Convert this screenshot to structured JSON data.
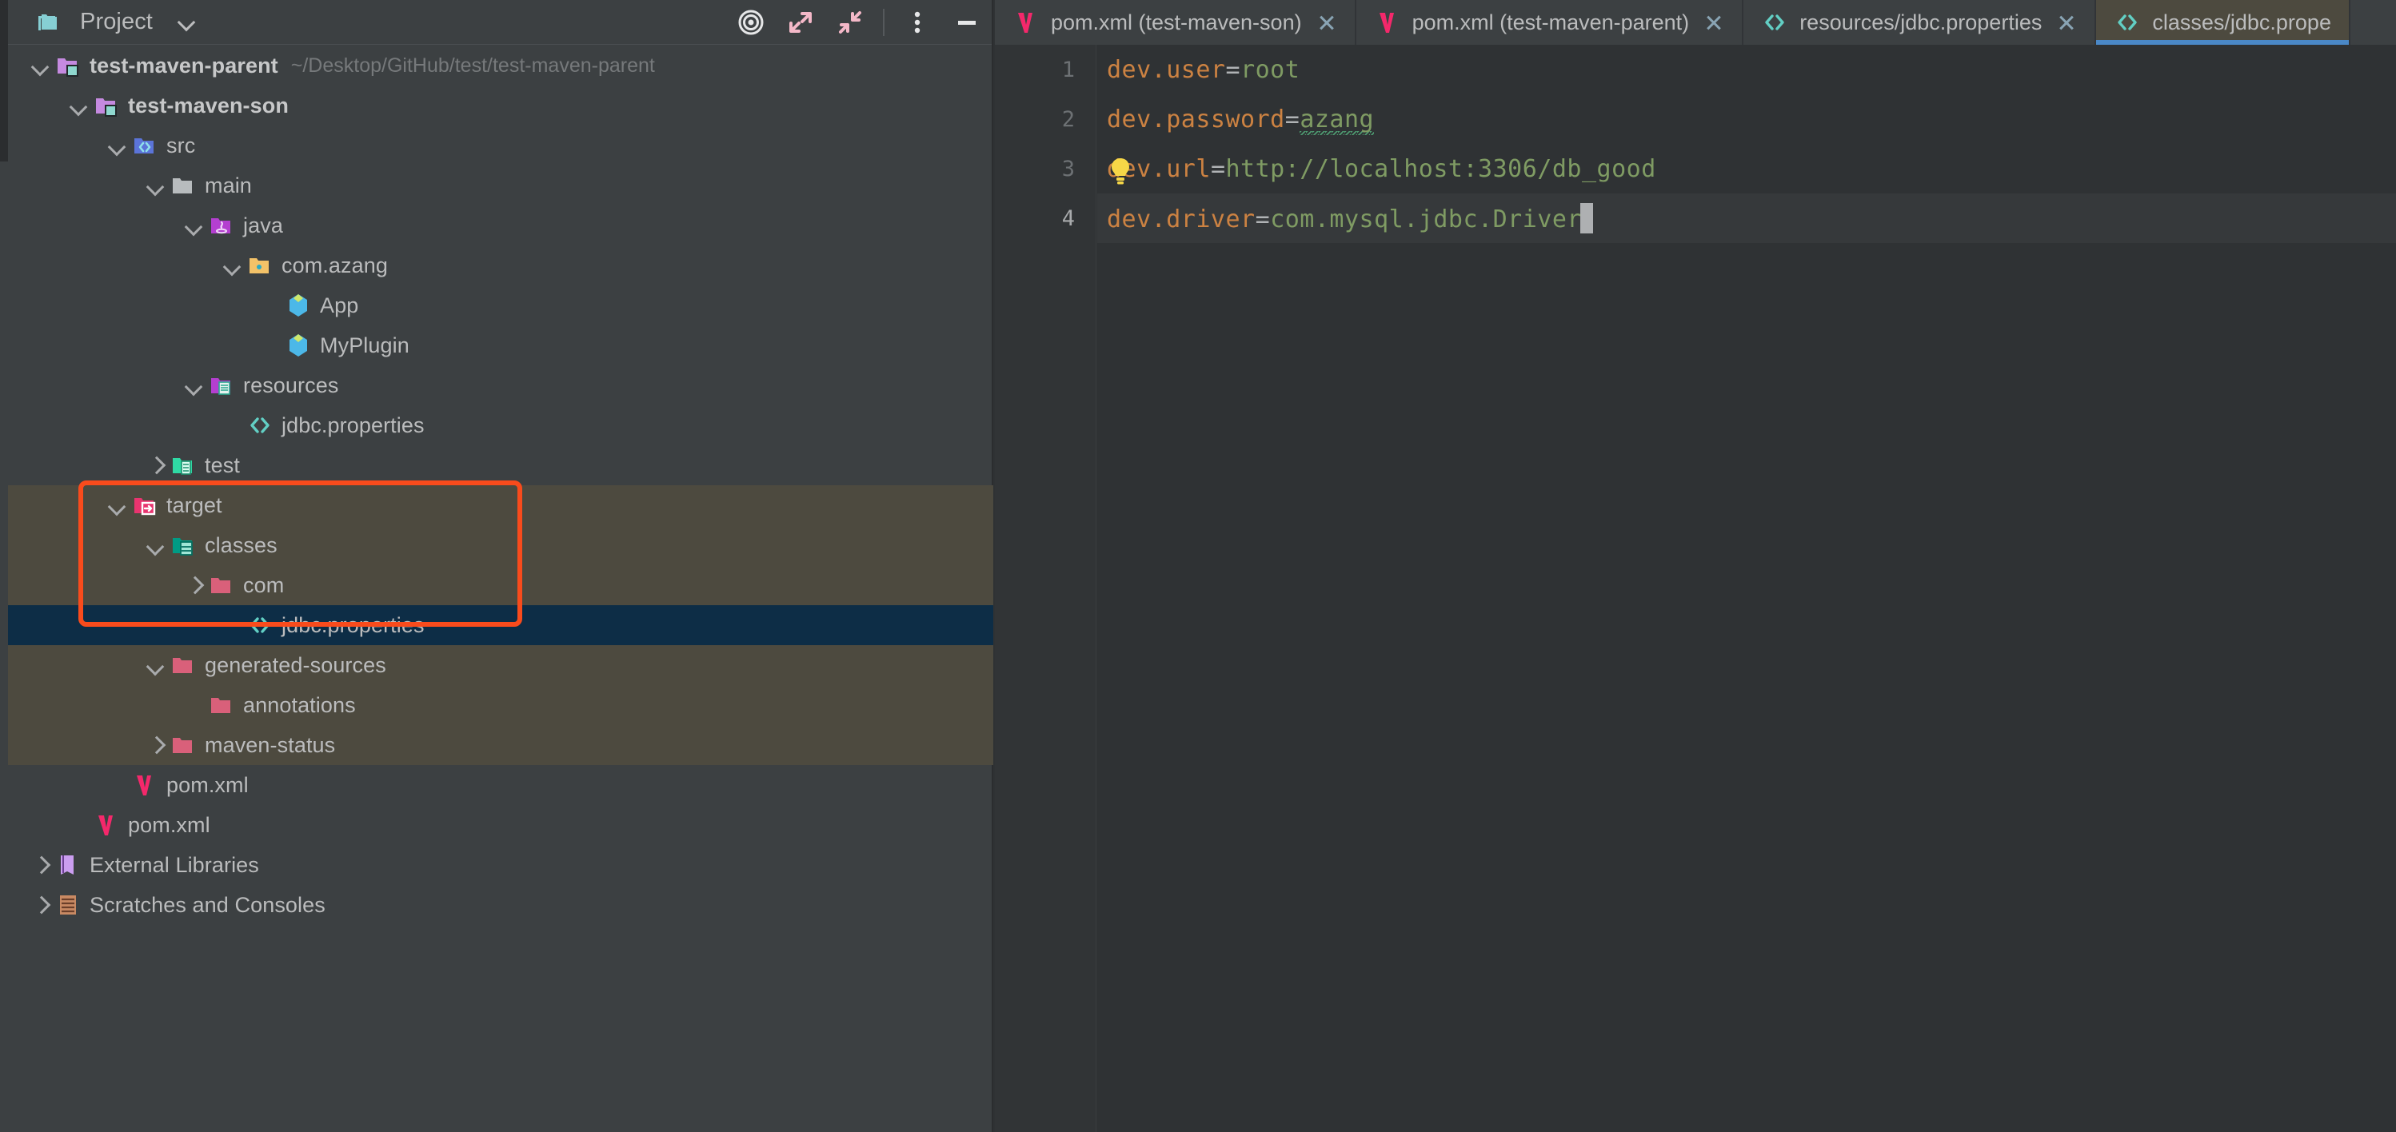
{
  "panel": {
    "title": "Project",
    "title_icon": "project-folder-icon",
    "dropdown_icon": "chevron-down-icon",
    "tools": [
      {
        "name": "locate-target-icon",
        "label": "Select Opened File"
      },
      {
        "name": "expand-all-icon",
        "label": "Expand All"
      },
      {
        "name": "collapse-all-icon",
        "label": "Collapse All"
      },
      {
        "name": "more-options-icon",
        "label": "Options"
      },
      {
        "name": "minimize-icon",
        "label": "Hide"
      }
    ]
  },
  "tree": [
    {
      "label": "test-maven-parent",
      "path_hint": "~/Desktop/GitHub/test/test-maven-parent",
      "depth": 0,
      "arrow": "down",
      "icon": "module-icon",
      "bold": true,
      "excluded": false,
      "selected": false
    },
    {
      "label": "test-maven-son",
      "path_hint": "",
      "depth": 1,
      "arrow": "down",
      "icon": "module-icon",
      "bold": true,
      "excluded": false,
      "selected": false
    },
    {
      "label": "src",
      "path_hint": "",
      "depth": 2,
      "arrow": "down",
      "icon": "source-folder-icon",
      "bold": false,
      "excluded": false,
      "selected": false
    },
    {
      "label": "main",
      "path_hint": "",
      "depth": 3,
      "arrow": "down",
      "icon": "folder-gray-icon",
      "bold": false,
      "excluded": false,
      "selected": false
    },
    {
      "label": "java",
      "path_hint": "",
      "depth": 4,
      "arrow": "down",
      "icon": "java-source-root-icon",
      "bold": false,
      "excluded": false,
      "selected": false
    },
    {
      "label": "com.azang",
      "path_hint": "",
      "depth": 5,
      "arrow": "down",
      "icon": "package-icon",
      "bold": false,
      "excluded": false,
      "selected": false
    },
    {
      "label": "App",
      "path_hint": "",
      "depth": 6,
      "arrow": "none",
      "icon": "java-class-icon",
      "bold": false,
      "excluded": false,
      "selected": false
    },
    {
      "label": "MyPlugin",
      "path_hint": "",
      "depth": 6,
      "arrow": "none",
      "icon": "java-class-icon",
      "bold": false,
      "excluded": false,
      "selected": false
    },
    {
      "label": "resources",
      "path_hint": "",
      "depth": 4,
      "arrow": "down",
      "icon": "resource-root-icon",
      "bold": false,
      "excluded": false,
      "selected": false
    },
    {
      "label": "jdbc.properties",
      "path_hint": "",
      "depth": 5,
      "arrow": "none",
      "icon": "properties-file-icon",
      "bold": false,
      "excluded": false,
      "selected": false
    },
    {
      "label": "test",
      "path_hint": "",
      "depth": 3,
      "arrow": "right",
      "icon": "test-root-icon",
      "bold": false,
      "excluded": false,
      "selected": false
    },
    {
      "label": "target",
      "path_hint": "",
      "depth": 2,
      "arrow": "down",
      "icon": "excluded-output-icon",
      "bold": false,
      "excluded": true,
      "selected": false
    },
    {
      "label": "classes",
      "path_hint": "",
      "depth": 3,
      "arrow": "down",
      "icon": "module-output-icon",
      "bold": false,
      "excluded": true,
      "selected": false
    },
    {
      "label": "com",
      "path_hint": "",
      "depth": 4,
      "arrow": "right",
      "icon": "folder-rose-icon",
      "bold": false,
      "excluded": true,
      "selected": false
    },
    {
      "label": "jdbc.properties",
      "path_hint": "",
      "depth": 5,
      "arrow": "none",
      "icon": "properties-file-icon",
      "bold": false,
      "excluded": false,
      "selected": true
    },
    {
      "label": "generated-sources",
      "path_hint": "",
      "depth": 3,
      "arrow": "down",
      "icon": "folder-rose-icon",
      "bold": false,
      "excluded": true,
      "selected": false
    },
    {
      "label": "annotations",
      "path_hint": "",
      "depth": 4,
      "arrow": "none",
      "icon": "folder-rose-icon",
      "bold": false,
      "excluded": true,
      "selected": false
    },
    {
      "label": "maven-status",
      "path_hint": "",
      "depth": 3,
      "arrow": "right",
      "icon": "folder-rose-icon",
      "bold": false,
      "excluded": true,
      "selected": false
    },
    {
      "label": "pom.xml",
      "path_hint": "",
      "depth": 2,
      "arrow": "none",
      "icon": "maven-icon",
      "bold": false,
      "excluded": false,
      "selected": false
    },
    {
      "label": "pom.xml",
      "path_hint": "",
      "depth": 1,
      "arrow": "none",
      "icon": "maven-icon",
      "bold": false,
      "excluded": false,
      "selected": false
    },
    {
      "label": "External Libraries",
      "path_hint": "",
      "depth": 0,
      "arrow": "right",
      "icon": "library-icon",
      "bold": false,
      "excluded": false,
      "selected": false
    },
    {
      "label": "Scratches and Consoles",
      "path_hint": "",
      "depth": 0,
      "arrow": "right",
      "icon": "scratches-icon",
      "bold": false,
      "excluded": false,
      "selected": false
    }
  ],
  "tabs": [
    {
      "label": "pom.xml (test-maven-son)",
      "icon": "maven-icon",
      "active": false,
      "closable": true
    },
    {
      "label": "pom.xml (test-maven-parent)",
      "icon": "maven-icon",
      "active": false,
      "closable": true
    },
    {
      "label": "resources/jdbc.properties",
      "icon": "properties-file-icon",
      "active": false,
      "closable": true
    },
    {
      "label": "classes/jdbc.prope",
      "icon": "properties-file-icon",
      "active": true,
      "closable": false
    }
  ],
  "editor": {
    "lines": [
      {
        "num": "1",
        "key": "dev.user",
        "eq": "=",
        "value": "root",
        "squiggly": false,
        "current": false,
        "bulb": false,
        "caret": false
      },
      {
        "num": "2",
        "key": "dev.password",
        "eq": "=",
        "value": "azang",
        "squiggly": true,
        "current": false,
        "bulb": false,
        "caret": false
      },
      {
        "num": "3",
        "key": "dev.url",
        "eq": "=",
        "value": "http://localhost:3306/db_good",
        "squiggly": false,
        "current": false,
        "bulb": true,
        "caret": false
      },
      {
        "num": "4",
        "key": "dev.driver",
        "eq": "=",
        "value": "com.mysql.jdbc.Driver",
        "squiggly": false,
        "current": true,
        "bulb": false,
        "caret": true
      }
    ]
  },
  "colors": {
    "panel_bg": "#3c4042",
    "editor_bg": "#2f3234",
    "excluded_bg": "#4d4a3f",
    "selected_bg": "#0d2d46",
    "annotation": "#f94b1c",
    "tab_underline": "#4a88c7",
    "key_color": "#cc8242",
    "value_color": "#7f9b63"
  }
}
